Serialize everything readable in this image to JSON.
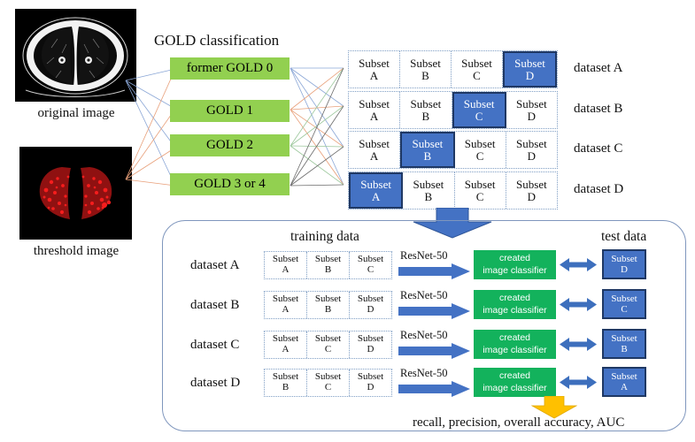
{
  "figure": {
    "left_images": [
      {
        "caption": "original image",
        "kind": "ct-axial-lung-window"
      },
      {
        "caption": "threshold image",
        "kind": "ct-threshold-red-overlay"
      }
    ],
    "gold": {
      "title": "GOLD classification",
      "classes": [
        {
          "label": "former GOLD 0"
        },
        {
          "label": "GOLD 1"
        },
        {
          "label": "GOLD 2"
        },
        {
          "label": "GOLD 3 or 4"
        }
      ]
    },
    "split_grid": {
      "rows": [
        {
          "dataset": "dataset A",
          "cells": [
            {
              "l1": "Subset",
              "l2": "A",
              "selected": false
            },
            {
              "l1": "Subset",
              "l2": "B",
              "selected": false
            },
            {
              "l1": "Subset",
              "l2": "C",
              "selected": false
            },
            {
              "l1": "Subset",
              "l2": "D",
              "selected": true
            }
          ]
        },
        {
          "dataset": "dataset B",
          "cells": [
            {
              "l1": "Subset",
              "l2": "A",
              "selected": false
            },
            {
              "l1": "Subset",
              "l2": "B",
              "selected": false
            },
            {
              "l1": "Subset",
              "l2": "C",
              "selected": true
            },
            {
              "l1": "Subset",
              "l2": "D",
              "selected": false
            }
          ]
        },
        {
          "dataset": "dataset C",
          "cells": [
            {
              "l1": "Subset",
              "l2": "A",
              "selected": false
            },
            {
              "l1": "Subset",
              "l2": "B",
              "selected": true
            },
            {
              "l1": "Subset",
              "l2": "C",
              "selected": false
            },
            {
              "l1": "Subset",
              "l2": "D",
              "selected": false
            }
          ]
        },
        {
          "dataset": "dataset D",
          "cells": [
            {
              "l1": "Subset",
              "l2": "A",
              "selected": true
            },
            {
              "l1": "Subset",
              "l2": "B",
              "selected": false
            },
            {
              "l1": "Subset",
              "l2": "C",
              "selected": false
            },
            {
              "l1": "Subset",
              "l2": "D",
              "selected": false
            }
          ]
        }
      ]
    },
    "experiment_panel": {
      "training_title": "training data",
      "test_title": "test data",
      "model_label": "ResNet-50",
      "classifier_line1": "created",
      "classifier_line2": "image classifier",
      "metrics": "recall, precision, overall accuracy, AUC",
      "rows": [
        {
          "dataset": "dataset A",
          "training": [
            {
              "l1": "Subset",
              "l2": "A"
            },
            {
              "l1": "Subset",
              "l2": "B"
            },
            {
              "l1": "Subset",
              "l2": "C"
            }
          ],
          "test": {
            "l1": "Subset",
            "l2": "D"
          }
        },
        {
          "dataset": "dataset B",
          "training": [
            {
              "l1": "Subset",
              "l2": "A"
            },
            {
              "l1": "Subset",
              "l2": "B"
            },
            {
              "l1": "Subset",
              "l2": "D"
            }
          ],
          "test": {
            "l1": "Subset",
            "l2": "C"
          }
        },
        {
          "dataset": "dataset C",
          "training": [
            {
              "l1": "Subset",
              "l2": "A"
            },
            {
              "l1": "Subset",
              "l2": "C"
            },
            {
              "l1": "Subset",
              "l2": "D"
            }
          ],
          "test": {
            "l1": "Subset",
            "l2": "B"
          }
        },
        {
          "dataset": "dataset D",
          "training": [
            {
              "l1": "Subset",
              "l2": "B"
            },
            {
              "l1": "Subset",
              "l2": "C"
            },
            {
              "l1": "Subset",
              "l2": "D"
            }
          ],
          "test": {
            "l1": "Subset",
            "l2": "A"
          }
        }
      ]
    },
    "colors": {
      "gold_green": "#92d050",
      "classifier_green": "#13b25c",
      "subset_blue": "#4472c4",
      "subset_blue_border": "#1f3864",
      "arrow_blue": "#4472c4",
      "arrow_yellow": "#ffc000",
      "panel_outline": "#7f96bd",
      "dotted_border": "#7f9ec4"
    }
  }
}
